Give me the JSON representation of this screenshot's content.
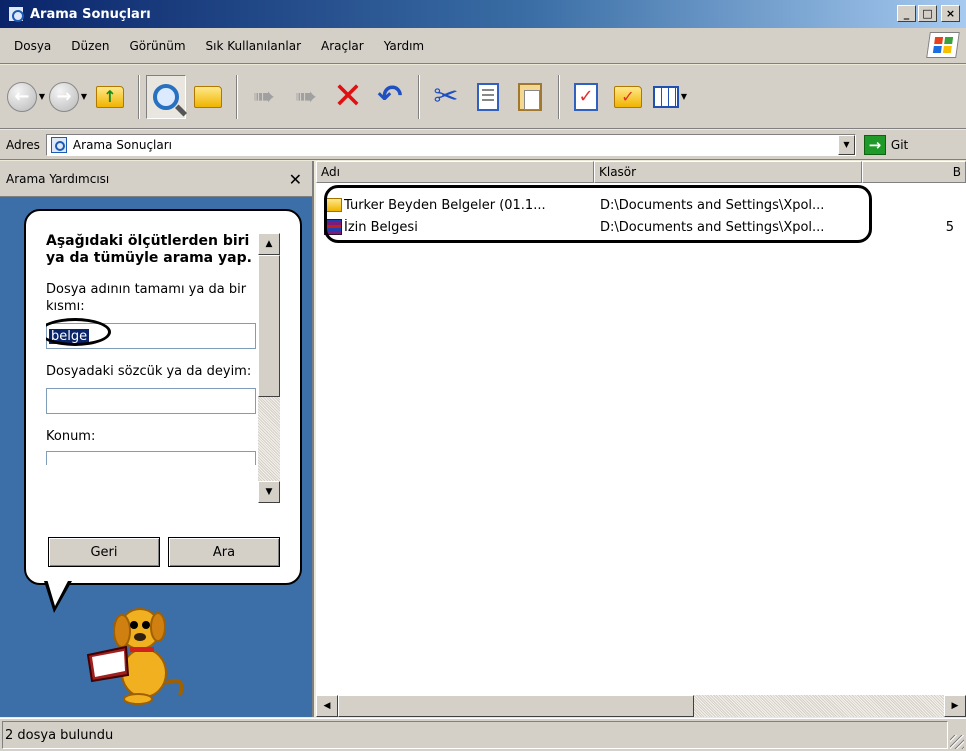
{
  "window": {
    "title": "Arama Sonuçları",
    "min": "_",
    "max": "□",
    "close": "×"
  },
  "menu": {
    "items": [
      {
        "label": "Dosya"
      },
      {
        "label": "Düzen"
      },
      {
        "label": "Görünüm"
      },
      {
        "label": "Sık Kullanılanlar"
      },
      {
        "label": "Araçlar"
      },
      {
        "label": "Yardım"
      }
    ]
  },
  "toolbar": {
    "icons": [
      "back-icon",
      "forward-icon",
      "up-folder-icon",
      "search-icon",
      "folders-icon",
      "move-to-icon",
      "copy-to-icon",
      "delete-icon",
      "undo-icon",
      "cut-icon",
      "copy-icon",
      "paste-icon",
      "checklist-icon",
      "select-icon",
      "views-icon"
    ]
  },
  "address": {
    "label": "Adres",
    "value": "Arama Sonuçları",
    "go_label": "Git"
  },
  "left_pane": {
    "title": "Arama Yardımcısı",
    "heading": "Aşağıdaki ölçütlerden biri ya da tümüyle arama yap.",
    "filename_label": "Dosya adının tamamı ya da bir kısmı:",
    "filename_value": "belge",
    "word_label": "Dosyadaki sözcük ya da deyim:",
    "word_value": "",
    "location_label": "Konum:",
    "back_button": "Geri",
    "search_button": "Ara"
  },
  "results": {
    "columns": [
      "Adı",
      "Klasör",
      "B"
    ],
    "rows": [
      {
        "name": "Turker Beyden Belgeler (01.1...",
        "folder": "D:\\Documents and Settings\\Xpol...",
        "size": "",
        "icon": "folder-icon"
      },
      {
        "name": "İzin Belgesi",
        "folder": "D:\\Documents and Settings\\Xpol...",
        "size": "5",
        "icon": "rar-archive-icon"
      }
    ]
  },
  "status": {
    "text": "2 dosya bulundu"
  }
}
